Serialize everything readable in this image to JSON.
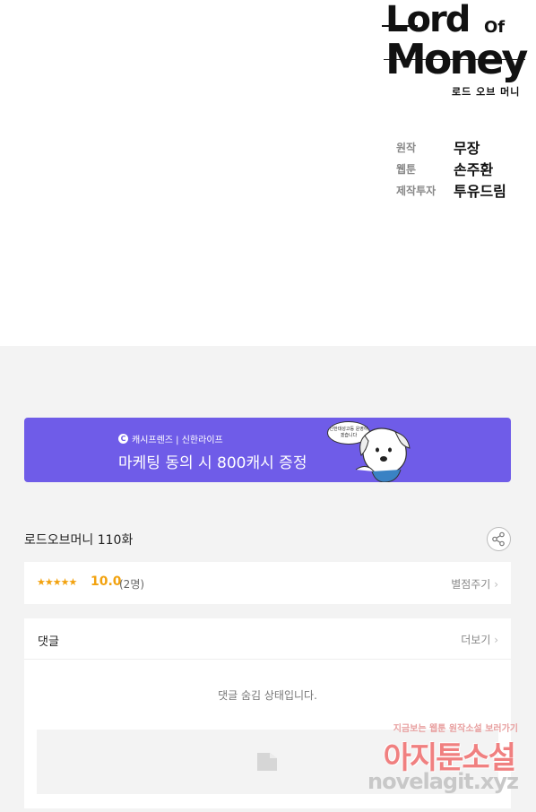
{
  "comic": {
    "logo": {
      "line1": "Lord",
      "of": "Of",
      "line2": "Money",
      "korean": "로드 오브 머니"
    },
    "credits": [
      {
        "label": "원작",
        "value": "무장"
      },
      {
        "label": "웹툰",
        "value": "손주환"
      },
      {
        "label": "제작투자",
        "value": "투유드림"
      }
    ]
  },
  "banner": {
    "brand": "캐시프렌즈 | 신한라이프",
    "title": "마케팅 동의 시 800캐시 증정",
    "bubble": "신한대성고등 운영하겠습니다",
    "color": "#6f5ce8"
  },
  "episode": {
    "title": "로드오브머니 110화"
  },
  "rating": {
    "stars": "★★★★★",
    "score": "10.0",
    "count": "(2명)",
    "rate_label": "별점주기",
    "stars_filled": 5,
    "stars_total": 5
  },
  "comments": {
    "title": "댓글",
    "more_label": "더보기",
    "hidden_message": "댓글 숨김 상태입니다."
  },
  "watermark": {
    "top": "지금보는 웹툰 원작소설 보러가기",
    "main": "아지툰소설",
    "site": "novelagit.xyz"
  },
  "colors": {
    "accent": "#f2a20f",
    "background": "#f3f3f3"
  }
}
